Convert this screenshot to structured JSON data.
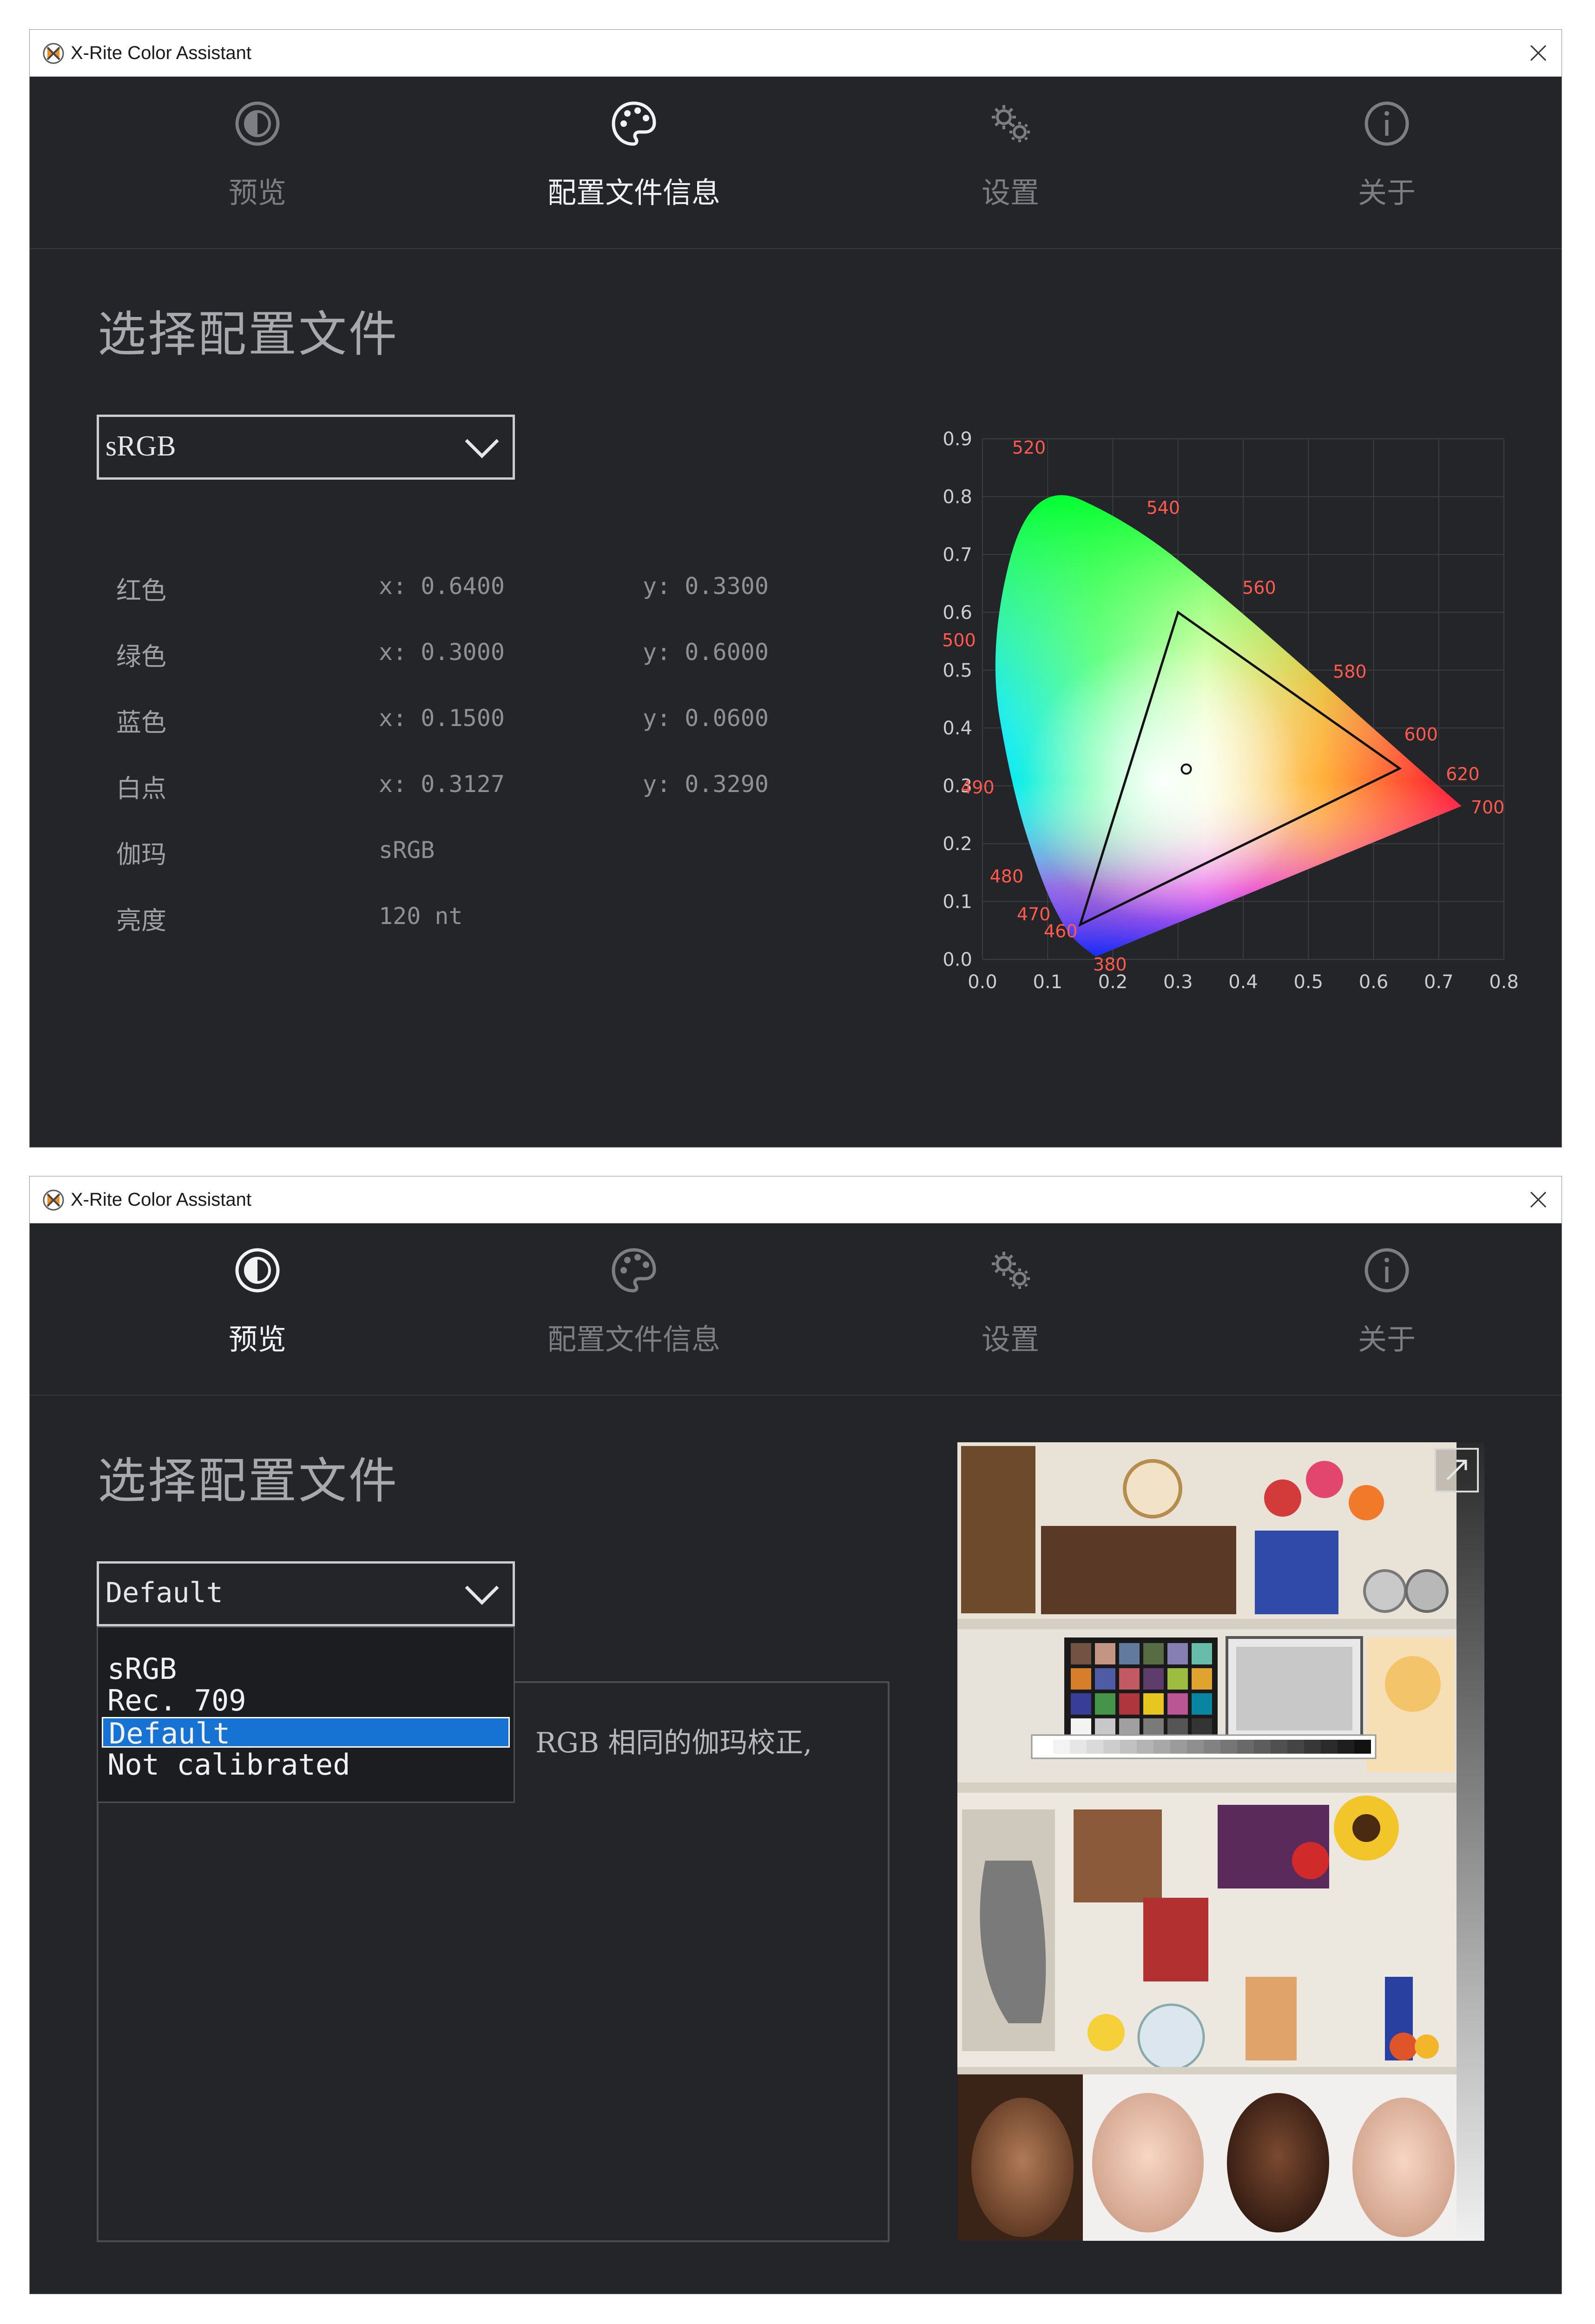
{
  "window1": {
    "title": "X-Rite Color Assistant",
    "nav": [
      {
        "label": "预览",
        "icon": "preview-icon",
        "active": false
      },
      {
        "label": "配置文件信息",
        "icon": "palette-icon",
        "active": true
      },
      {
        "label": "设置",
        "icon": "gears-icon",
        "active": false
      },
      {
        "label": "关于",
        "icon": "info-icon",
        "active": false
      }
    ],
    "section_title": "选择配置文件",
    "selected_profile": "sRGB",
    "profile_info": [
      {
        "label": "红色",
        "x": "x: 0.6400",
        "y": "y: 0.3300"
      },
      {
        "label": "绿色",
        "x": "x: 0.3000",
        "y": "y: 0.6000"
      },
      {
        "label": "蓝色",
        "x": "x: 0.1500",
        "y": "y: 0.0600"
      },
      {
        "label": "白点",
        "x": "x: 0.3127",
        "y": "y: 0.3290"
      },
      {
        "label": "伽玛",
        "x": "sRGB",
        "y": ""
      },
      {
        "label": "亮度",
        "x": "120 nt",
        "y": ""
      }
    ]
  },
  "window2": {
    "title": "X-Rite Color Assistant",
    "nav": [
      {
        "label": "预览",
        "icon": "preview-icon",
        "active": true
      },
      {
        "label": "配置文件信息",
        "icon": "palette-icon",
        "active": false
      },
      {
        "label": "设置",
        "icon": "gears-icon",
        "active": false
      },
      {
        "label": "关于",
        "icon": "info-icon",
        "active": false
      }
    ],
    "section_title": "选择配置文件",
    "selected_profile": "Default",
    "dropdown_options": [
      "sRGB",
      "Rec. 709",
      "Default",
      "Not calibrated"
    ],
    "highlighted_option": "Default",
    "description_fragment": "RGB 相同的伽玛校正,"
  },
  "chart_data": {
    "type": "scatter",
    "title": "",
    "xlabel": "",
    "ylabel": "",
    "xlim": [
      0.0,
      0.8
    ],
    "ylim": [
      0.0,
      0.9
    ],
    "x_ticks": [
      "0.0",
      "0.1",
      "0.2",
      "0.3",
      "0.4",
      "0.5",
      "0.6",
      "0.7",
      "0.8"
    ],
    "y_ticks": [
      "0.0",
      "0.1",
      "0.2",
      "0.3",
      "0.4",
      "0.5",
      "0.6",
      "0.7",
      "0.8",
      "0.9"
    ],
    "grid": true,
    "spectral_locus": [
      {
        "nm": "380",
        "x": 0.174,
        "y": 0.005
      },
      {
        "nm": "460",
        "x": 0.144,
        "y": 0.03
      },
      {
        "nm": "470",
        "x": 0.124,
        "y": 0.058
      },
      {
        "nm": "480",
        "x": 0.091,
        "y": 0.133
      },
      {
        "nm": "490",
        "x": 0.045,
        "y": 0.295
      },
      {
        "nm": "500",
        "x": 0.008,
        "y": 0.538
      },
      {
        "nm": "520",
        "x": 0.074,
        "y": 0.834
      },
      {
        "nm": "540",
        "x": 0.23,
        "y": 0.754
      },
      {
        "nm": "560",
        "x": 0.373,
        "y": 0.624
      },
      {
        "nm": "580",
        "x": 0.512,
        "y": 0.487
      },
      {
        "nm": "600",
        "x": 0.627,
        "y": 0.372
      },
      {
        "nm": "620",
        "x": 0.691,
        "y": 0.308
      },
      {
        "nm": "700",
        "x": 0.735,
        "y": 0.265
      }
    ],
    "gamut_triangle": [
      {
        "name": "red",
        "x": 0.64,
        "y": 0.33
      },
      {
        "name": "green",
        "x": 0.3,
        "y": 0.6
      },
      {
        "name": "blue",
        "x": 0.15,
        "y": 0.06
      }
    ],
    "white_point": {
      "x": 0.3127,
      "y": 0.329
    },
    "label_color": "#ff5a4d"
  },
  "colors": {
    "background": "#232528",
    "active_tab_text": "#f2f2f2",
    "inactive_tab_text": "#7b7e83",
    "dropdown_highlight": "#1673d4"
  }
}
